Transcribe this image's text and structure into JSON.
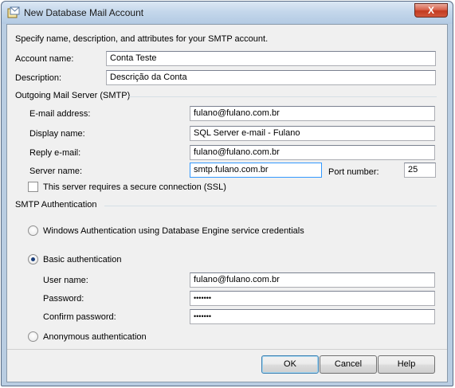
{
  "window": {
    "title": "New Database Mail Account",
    "close_label": "X"
  },
  "intro": "Specify name, description, and attributes for your SMTP account.",
  "account": {
    "name_label": "Account name:",
    "name_value": "Conta Teste",
    "description_label": "Description:",
    "description_value": "Descrição da Conta"
  },
  "smtp": {
    "group_label": "Outgoing Mail Server (SMTP)",
    "email_label": "E-mail address:",
    "email_value": "fulano@fulano.com.br",
    "display_label": "Display name:",
    "display_value": "SQL Server e-mail - Fulano",
    "reply_label": "Reply e-mail:",
    "reply_value": "fulano@fulano.com.br",
    "server_label": "Server name:",
    "server_value": "smtp.fulano.com.br",
    "port_label": "Port number:",
    "port_value": "25",
    "ssl_label": "This server requires a secure connection (SSL)",
    "ssl_checked": false
  },
  "auth": {
    "group_label": "SMTP Authentication",
    "windows_label": "Windows Authentication using Database Engine service credentials",
    "basic_label": "Basic authentication",
    "selected": "basic",
    "user_label": "User name:",
    "user_value": "fulano@fulano.com.br",
    "password_label": "Password:",
    "password_value": "•••••••",
    "confirm_label": "Confirm password:",
    "confirm_value": "•••••••",
    "anonymous_label": "Anonymous authentication"
  },
  "buttons": {
    "ok": "OK",
    "cancel": "Cancel",
    "help": "Help"
  },
  "colors": {
    "title_bar": "#c4d7eb",
    "close_button": "#d2573c",
    "focus_border": "#3399ff"
  },
  "icons": {
    "title": "mail-account-icon"
  }
}
